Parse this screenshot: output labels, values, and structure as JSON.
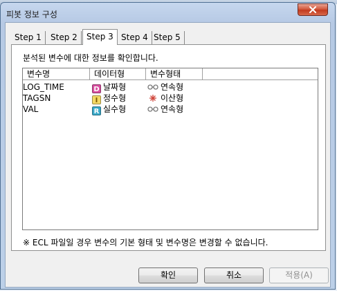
{
  "dialog": {
    "title": "피봇 정보 구성",
    "close_icon": "close-icon"
  },
  "tabs": [
    {
      "label": "Step 1",
      "active": false
    },
    {
      "label": "Step 2",
      "active": false
    },
    {
      "label": "Step 3",
      "active": true
    },
    {
      "label": "Step 4",
      "active": false
    },
    {
      "label": "Step 5",
      "active": false
    }
  ],
  "panel": {
    "instruction": "분석된 변수에 대한 정보를 확인합니다.",
    "columns": [
      "변수명",
      "데이터형",
      "변수형태"
    ],
    "rows": [
      {
        "name": "LOG_TIME",
        "data_badge": "D",
        "data_type": "날짜형",
        "var_icon": "continuous-icon",
        "var_type": "연속형"
      },
      {
        "name": "TAGSN",
        "data_badge": "I",
        "data_type": "정수형",
        "var_icon": "discrete-icon",
        "var_type": "이산형"
      },
      {
        "name": "VAL",
        "data_badge": "R",
        "data_type": "실수형",
        "var_icon": "continuous-icon",
        "var_type": "연속형"
      }
    ],
    "note": "※ ECL 파일일 경우 변수의 기본 형태 및 변수명은 변경할 수 없습니다."
  },
  "buttons": {
    "ok": "확인",
    "cancel": "취소",
    "apply": "적용(A)"
  },
  "colors": {
    "badge_D": "#d94fa0",
    "badge_I": "#f3d865",
    "badge_R": "#3aa9c9"
  }
}
